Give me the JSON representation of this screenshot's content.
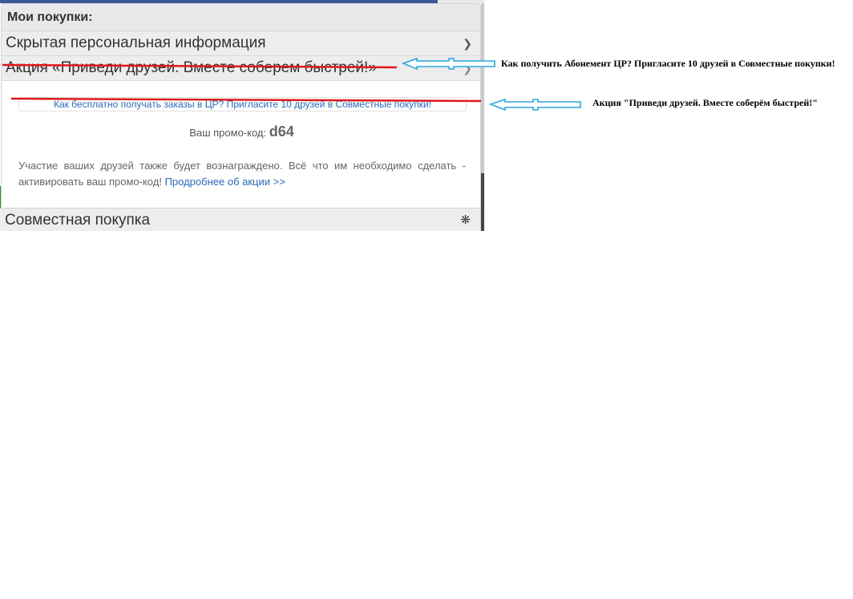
{
  "panel": {
    "title": "Мои покупки:"
  },
  "accordion": {
    "hidden_info_label": "Скрытая персональная информация",
    "promo_action_label": "Акция «Приведи друзей. Вместе соберем быстрей!»",
    "promo_link_text": "Как бесплатно получать заказы в ЦР? Пригласите 10 друзей в Совместные покупки!",
    "promo_code_label": "Ваш промо-код:",
    "promo_code_value": "d64",
    "description_text": "Участие ваших друзей также будет вознаграждено. Всё что им необходимо сделать - активировать ваш промо-код!",
    "details_link_text": "Продробнее об акции >>",
    "joint_purchase_label": "Совместная покупка"
  },
  "annotations": {
    "note_1": "Как получить Абонемент ЦР? Пригласите 10 друзей в Совместные покупки!",
    "note_2": "Акция \"Приведи друзей. Вместе соберём быстрей!\""
  },
  "colors": {
    "strike_red": "#e0191b",
    "arrow_blue": "#29a8e0",
    "link_blue": "#2a6ab8"
  },
  "icons": {
    "chevron": "chevron-down-icon",
    "asterisk": "asterisk-icon"
  }
}
